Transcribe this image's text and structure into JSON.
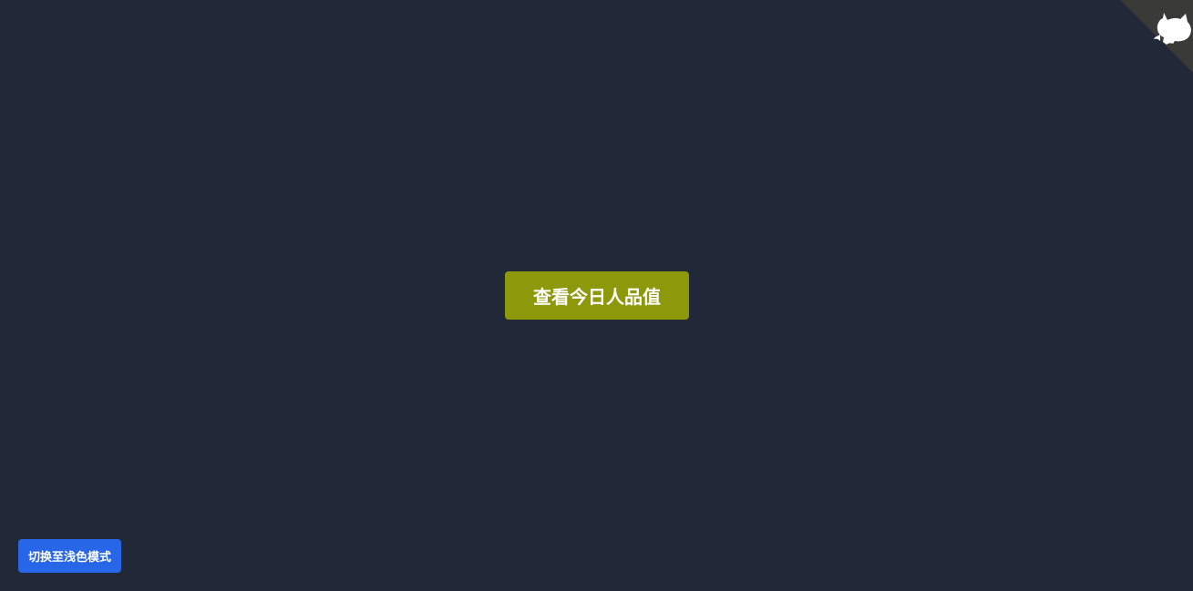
{
  "main": {
    "check_button_label": "查看今日人品值"
  },
  "footer": {
    "theme_toggle_label": "切换至浅色模式"
  },
  "corner": {
    "icon": "github-octocat-icon"
  },
  "colors": {
    "background": "#212837",
    "primary_button": "#8d980a",
    "theme_button": "#2866e8",
    "corner_banner": "#3a3a39",
    "icon": "#ffffff"
  }
}
